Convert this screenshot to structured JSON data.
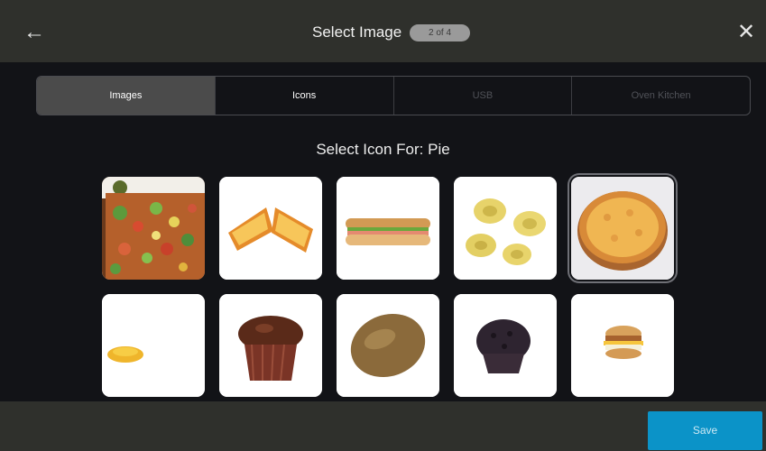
{
  "header": {
    "title": "Select Image",
    "step_badge": "2 of 4",
    "back_icon": "arrow-left-icon",
    "close_icon": "close-icon"
  },
  "tabs": [
    {
      "label": "Images",
      "active": true
    },
    {
      "label": "Icons",
      "active": false
    },
    {
      "label": "USB",
      "active": false,
      "disabled": true
    },
    {
      "label": "Oven Kitchen",
      "active": false,
      "disabled": true
    }
  ],
  "prompt": "Select Icon For: Pie",
  "images": [
    {
      "name": "pizza-slice-topped",
      "selected": false
    },
    {
      "name": "grilled-cheese-sandwich",
      "selected": false
    },
    {
      "name": "sub-sandwich",
      "selected": false
    },
    {
      "name": "tortellini",
      "selected": false
    },
    {
      "name": "cheese-pizza",
      "selected": true
    },
    {
      "name": "macaroni",
      "selected": false
    },
    {
      "name": "chocolate-muffin",
      "selected": false
    },
    {
      "name": "kiwi",
      "selected": false
    },
    {
      "name": "double-chocolate-muffin",
      "selected": false
    },
    {
      "name": "breakfast-sandwich",
      "selected": false
    }
  ],
  "footer": {
    "save_label": "Save"
  },
  "colors": {
    "header_bg": "#2f302c",
    "body_bg": "#121317",
    "active_tab": "#4b4b4b",
    "save_button": "#0b93c8"
  }
}
